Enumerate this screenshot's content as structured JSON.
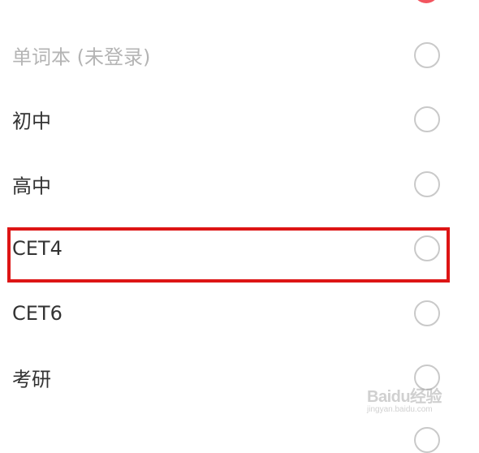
{
  "options": [
    {
      "label": "单词本 (未登录)",
      "disabled": true,
      "selected": false
    },
    {
      "label": "初中",
      "disabled": false,
      "selected": false
    },
    {
      "label": "高中",
      "disabled": false,
      "selected": false
    },
    {
      "label": "CET4",
      "disabled": false,
      "selected": false,
      "highlighted": true
    },
    {
      "label": "CET6",
      "disabled": false,
      "selected": false
    },
    {
      "label": "考研",
      "disabled": false,
      "selected": false
    }
  ],
  "colors": {
    "selected_radio": "#f2555f",
    "radio_border": "#c9c9c9",
    "highlight_box": "#dd1515",
    "disabled_text": "#b4b4b4",
    "text": "#333333"
  },
  "watermark": {
    "logo": "Baidu经验",
    "url": "jingyan.baidu.com"
  }
}
